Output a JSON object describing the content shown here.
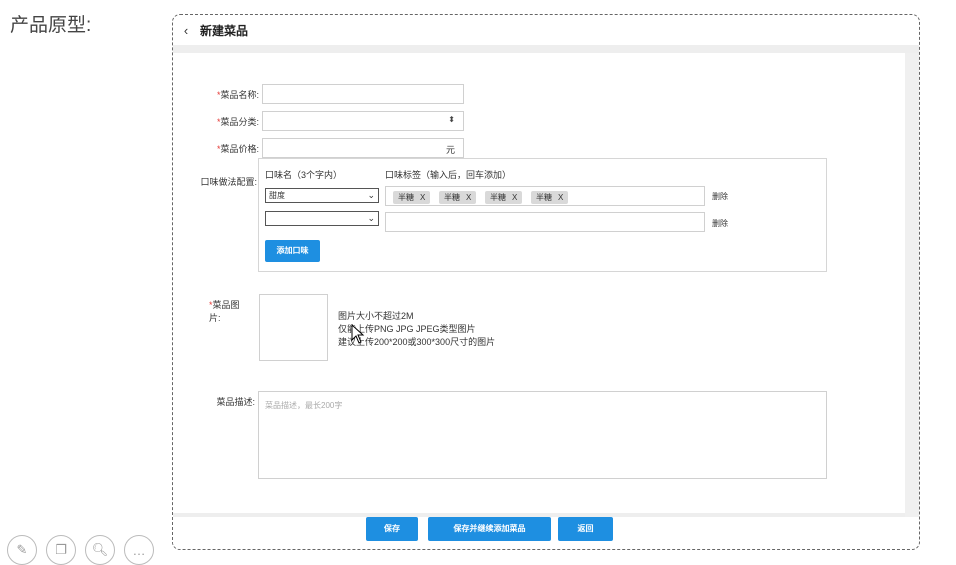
{
  "page_label": "产品原型:",
  "header": {
    "title": "新建菜品",
    "back_icon": "chevron-left-icon"
  },
  "form": {
    "name_label": "菜品名称:",
    "category_label": "菜品分类:",
    "price_label": "菜品价格:",
    "price_suffix": "元",
    "required_mark": "*",
    "flavor_label": "口味做法配置:",
    "flavor_col_name": "口味名（3个字内）",
    "flavor_col_tags": "口味标签（输入后，回车添加）",
    "flavor_rows": [
      {
        "name": "甜度",
        "tags": [
          "半糖",
          "半糖",
          "半糖",
          "半糖"
        ],
        "delete": "删除"
      },
      {
        "name": "",
        "tags": [],
        "delete": "删除"
      }
    ],
    "tag_remove": "X",
    "add_flavor_button": "添加口味",
    "image_label": "菜品图片:",
    "image_hints": [
      "图片大小不超过2M",
      "仅能上传PNG JPG JPEG类型图片",
      "建议上传200*200或300*300尺寸的图片"
    ],
    "desc_label": "菜品描述:",
    "desc_placeholder": "菜品描述，最长200字"
  },
  "footer": {
    "save": "保存",
    "save_continue": "保存并继续添加菜品",
    "back": "返回"
  },
  "colors": {
    "primary": "#1e8fe1",
    "required": "#e53935"
  },
  "tools": [
    "pencil-icon",
    "copy-icon",
    "zoom-icon",
    "more-icon"
  ]
}
